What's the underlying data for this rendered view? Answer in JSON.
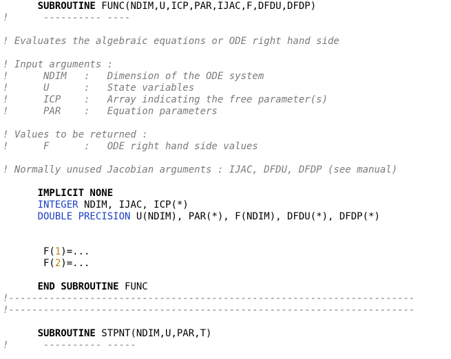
{
  "editor": {
    "language": "Fortran",
    "colors": {
      "background": "#ffffff",
      "comment": "#7a7a7a",
      "keyword": "#000000",
      "type": "#1a3fbf",
      "number": "#b8860b"
    },
    "lines": [
      [
        {
          "t": "      "
        },
        {
          "t": "SUBROUTINE",
          "c": "kw"
        },
        {
          "t": " FUNC(NDIM,U,ICP,PAR,IJAC,F,DFDU,DFDP)"
        }
      ],
      [
        {
          "t": "!      ---------- ----",
          "c": "cmt"
        }
      ],
      [],
      [
        {
          "t": "! Evaluates the algebraic equations or ODE right hand side",
          "c": "cmt"
        }
      ],
      [],
      [
        {
          "t": "! Input arguments :",
          "c": "cmt"
        }
      ],
      [
        {
          "t": "!      NDIM   :   Dimension of the ODE system",
          "c": "cmt"
        }
      ],
      [
        {
          "t": "!      U      :   State variables",
          "c": "cmt"
        }
      ],
      [
        {
          "t": "!      ICP    :   Array indicating the free parameter(s)",
          "c": "cmt"
        }
      ],
      [
        {
          "t": "!      PAR    :   Equation parameters",
          "c": "cmt"
        }
      ],
      [],
      [
        {
          "t": "! Values to be returned :",
          "c": "cmt"
        }
      ],
      [
        {
          "t": "!      F      :   ODE right hand side values",
          "c": "cmt"
        }
      ],
      [],
      [
        {
          "t": "! Normally unused Jacobian arguments : IJAC, DFDU, DFDP (see manual)",
          "c": "cmt"
        }
      ],
      [],
      [
        {
          "t": "      "
        },
        {
          "t": "IMPLICIT NONE",
          "c": "kw"
        }
      ],
      [
        {
          "t": "      "
        },
        {
          "t": "INTEGER",
          "c": "ty"
        },
        {
          "t": " NDIM, IJAC, ICP(*)"
        }
      ],
      [
        {
          "t": "      "
        },
        {
          "t": "DOUBLE PRECISION",
          "c": "ty"
        },
        {
          "t": " U(NDIM), PAR(*), F(NDIM), DFDU(*), DFDP(*)"
        }
      ],
      [],
      [],
      [
        {
          "t": "       F("
        },
        {
          "t": "1",
          "c": "num"
        },
        {
          "t": ")=..."
        }
      ],
      [
        {
          "t": "       F("
        },
        {
          "t": "2",
          "c": "num"
        },
        {
          "t": ")=..."
        }
      ],
      [],
      [
        {
          "t": "      "
        },
        {
          "t": "END SUBROUTINE",
          "c": "kw"
        },
        {
          "t": " FUNC"
        }
      ],
      [
        {
          "t": "!----------------------------------------------------------------------",
          "c": "cmt"
        }
      ],
      [
        {
          "t": "!----------------------------------------------------------------------",
          "c": "cmt"
        }
      ],
      [],
      [
        {
          "t": "      "
        },
        {
          "t": "SUBROUTINE",
          "c": "kw"
        },
        {
          "t": " STPNT(NDIM,U,PAR,T)"
        }
      ],
      [
        {
          "t": "!      ---------- -----",
          "c": "cmt"
        }
      ]
    ]
  }
}
